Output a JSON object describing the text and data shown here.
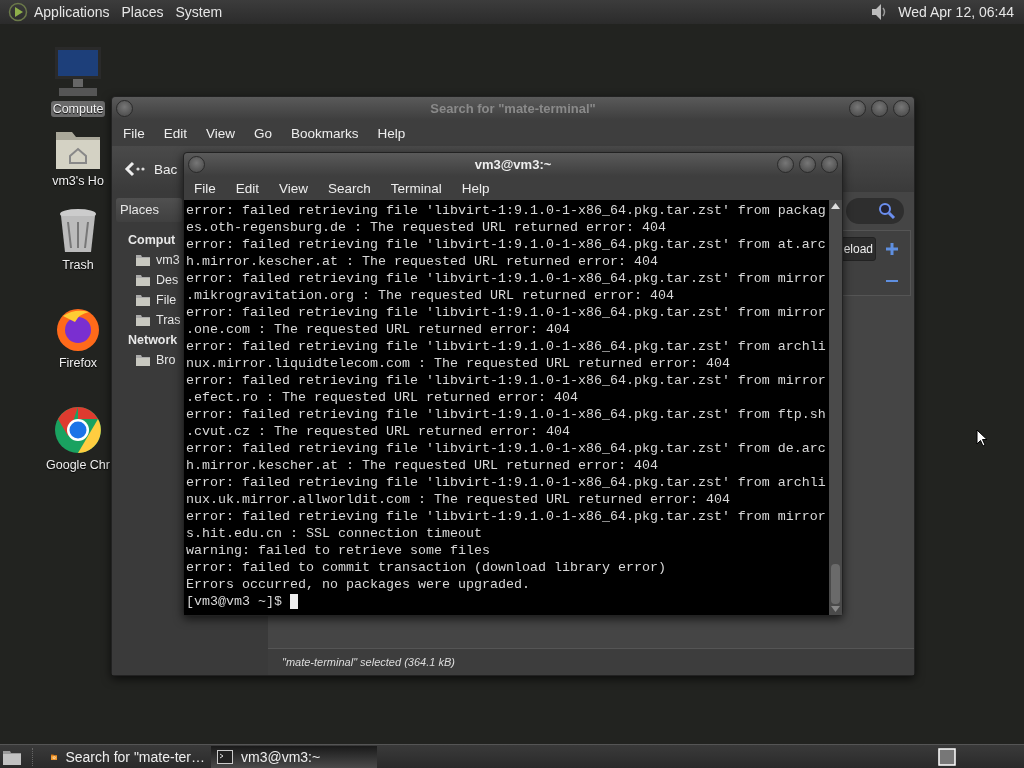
{
  "top_panel": {
    "menus": [
      "Applications",
      "Places",
      "System"
    ],
    "clock": "Wed Apr 12, 06:44"
  },
  "desktop_icons": [
    {
      "label": "Compute",
      "selected": true
    },
    {
      "label": "vm3's Ho",
      "selected": false
    },
    {
      "label": "Trash",
      "selected": false
    },
    {
      "label": "Firefox",
      "selected": false
    },
    {
      "label": "Google Chr",
      "selected": false
    }
  ],
  "file_manager": {
    "title": "Search for \"mate-terminal\"",
    "menu": [
      "File",
      "Edit",
      "View",
      "Go",
      "Bookmarks",
      "Help"
    ],
    "back_button": "Bac",
    "sidebar": {
      "header": "Places",
      "groups": [
        {
          "label": "Comput",
          "items": [
            "vm3",
            "Des",
            "File",
            "Tras"
          ]
        },
        {
          "label": "Network",
          "items": [
            "Bro"
          ]
        }
      ]
    },
    "reload_button": "eload",
    "status": "\"mate-terminal\" selected (364.1 kB)"
  },
  "terminal": {
    "title": "vm3@vm3:~",
    "menu": [
      "File",
      "Edit",
      "View",
      "Search",
      "Terminal",
      "Help"
    ],
    "lines": [
      "error: failed retrieving file 'libvirt-1:9.1.0-1-x86_64.pkg.tar.zst' from packag",
      "es.oth-regensburg.de : The requested URL returned error: 404",
      "error: failed retrieving file 'libvirt-1:9.1.0-1-x86_64.pkg.tar.zst' from at.arc",
      "h.mirror.kescher.at : The requested URL returned error: 404",
      "error: failed retrieving file 'libvirt-1:9.1.0-1-x86_64.pkg.tar.zst' from mirror",
      ".mikrogravitation.org : The requested URL returned error: 404",
      "error: failed retrieving file 'libvirt-1:9.1.0-1-x86_64.pkg.tar.zst' from mirror",
      ".one.com : The requested URL returned error: 404",
      "error: failed retrieving file 'libvirt-1:9.1.0-1-x86_64.pkg.tar.zst' from archli",
      "nux.mirror.liquidtelecom.com : The requested URL returned error: 404",
      "error: failed retrieving file 'libvirt-1:9.1.0-1-x86_64.pkg.tar.zst' from mirror",
      ".efect.ro : The requested URL returned error: 404",
      "error: failed retrieving file 'libvirt-1:9.1.0-1-x86_64.pkg.tar.zst' from ftp.sh",
      ".cvut.cz : The requested URL returned error: 404",
      "error: failed retrieving file 'libvirt-1:9.1.0-1-x86_64.pkg.tar.zst' from de.arc",
      "h.mirror.kescher.at : The requested URL returned error: 404",
      "error: failed retrieving file 'libvirt-1:9.1.0-1-x86_64.pkg.tar.zst' from archli",
      "nux.uk.mirror.allworldit.com : The requested URL returned error: 404",
      "error: failed retrieving file 'libvirt-1:9.1.0-1-x86_64.pkg.tar.zst' from mirror",
      "s.hit.edu.cn : SSL connection timeout",
      "warning: failed to retrieve some files",
      "error: failed to commit transaction (download library error)",
      "Errors occurred, no packages were upgraded."
    ],
    "prompt": "[vm3@vm3 ~]$"
  },
  "taskbar": [
    {
      "label": "Search for \"mate-ter…",
      "selected": false
    },
    {
      "label": "vm3@vm3:~",
      "selected": true
    }
  ]
}
